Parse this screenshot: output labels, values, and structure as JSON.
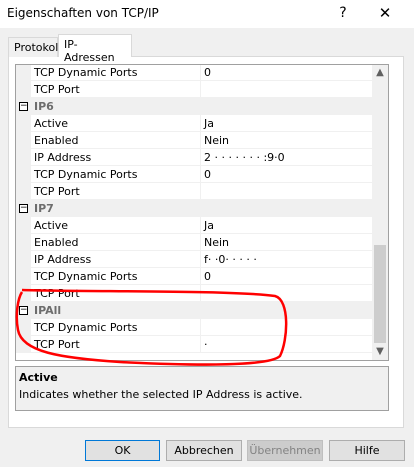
{
  "window": {
    "title": "Eigenschaften von TCP/IP",
    "help_glyph": "?",
    "close_glyph": "✕"
  },
  "tabs": [
    {
      "label": "Protokoll"
    },
    {
      "label": "IP-Adressen"
    }
  ],
  "grid": {
    "rows": [
      {
        "type": "prop",
        "name": "TCP Dynamic Ports",
        "value": "0"
      },
      {
        "type": "prop",
        "name": "TCP Port",
        "value": ""
      },
      {
        "type": "cat",
        "name": "IP6",
        "toggle": "−"
      },
      {
        "type": "prop",
        "name": "Active",
        "value": "Ja"
      },
      {
        "type": "prop",
        "name": "Enabled",
        "value": "Nein"
      },
      {
        "type": "prop",
        "name": "IP Address",
        "value": "2 ·   ·         ·   · ·                              · ·   :9·0"
      },
      {
        "type": "prop",
        "name": "TCP Dynamic Ports",
        "value": "0"
      },
      {
        "type": "prop",
        "name": "TCP Port",
        "value": ""
      },
      {
        "type": "cat",
        "name": "IP7",
        "toggle": "−"
      },
      {
        "type": "prop",
        "name": "Active",
        "value": "Ja"
      },
      {
        "type": "prop",
        "name": "Enabled",
        "value": "Nein"
      },
      {
        "type": "prop",
        "name": "IP Address",
        "value": "f· ·0·          ·                 ·   ·  ·"
      },
      {
        "type": "prop",
        "name": "TCP Dynamic Ports",
        "value": "0"
      },
      {
        "type": "prop",
        "name": "TCP Port",
        "value": ""
      },
      {
        "type": "cat",
        "name": "IPAll",
        "toggle": "−"
      },
      {
        "type": "prop",
        "name": "TCP Dynamic Ports",
        "value": ""
      },
      {
        "type": "prop",
        "name": "TCP Port",
        "value": "·"
      }
    ],
    "scroll_up_glyph": "▲",
    "scroll_down_glyph": "▼"
  },
  "description": {
    "title": "Active",
    "text": "Indicates whether the selected IP Address is active."
  },
  "buttons": {
    "ok": "OK",
    "cancel": "Abbrechen",
    "apply": "Übernehmen",
    "help": "Hilfe"
  },
  "colors": {
    "annotation": "#ff0000",
    "ok_border": "#0078d7"
  }
}
